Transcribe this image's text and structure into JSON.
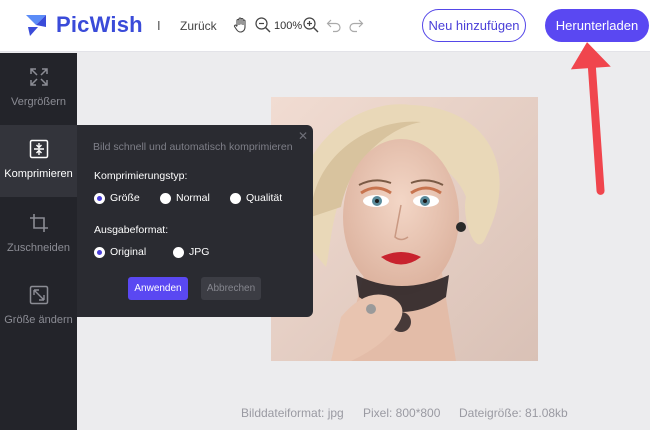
{
  "header": {
    "brand": "PicWish",
    "separator": "I",
    "back_label": "Zurück",
    "zoom_level": "100%",
    "add_new_label": "Neu hinzufügen",
    "download_label": "Herunterladen"
  },
  "sidebar": {
    "items": [
      {
        "label": "Vergrößern",
        "icon": "enlarge-icon"
      },
      {
        "label": "Komprimieren",
        "icon": "compress-icon",
        "active": true
      },
      {
        "label": "Zuschneiden",
        "icon": "crop-icon"
      },
      {
        "label": "Größe ändern",
        "icon": "resize-icon"
      }
    ]
  },
  "popup": {
    "hint": "Bild schnell und automatisch komprimieren",
    "compression_type_title": "Komprimierungstyp:",
    "compression_options": [
      "Größe",
      "Normal",
      "Qualität"
    ],
    "compression_selected": "Größe",
    "format_title": "Ausgabeformat:",
    "format_options": [
      "Original",
      "JPG"
    ],
    "format_selected": "Original",
    "apply_label": "Anwenden",
    "cancel_label": "Abbrechen"
  },
  "info": {
    "format": "Bilddateiformat: jpg",
    "pixels": "Pixel: 800*800",
    "size": "Dateigröße: 81.08kb"
  },
  "colors": {
    "brand": "#3a4bd9",
    "accent": "#5a48f2",
    "sidebar_bg": "#23242a",
    "annotation_arrow": "#f0454d"
  }
}
